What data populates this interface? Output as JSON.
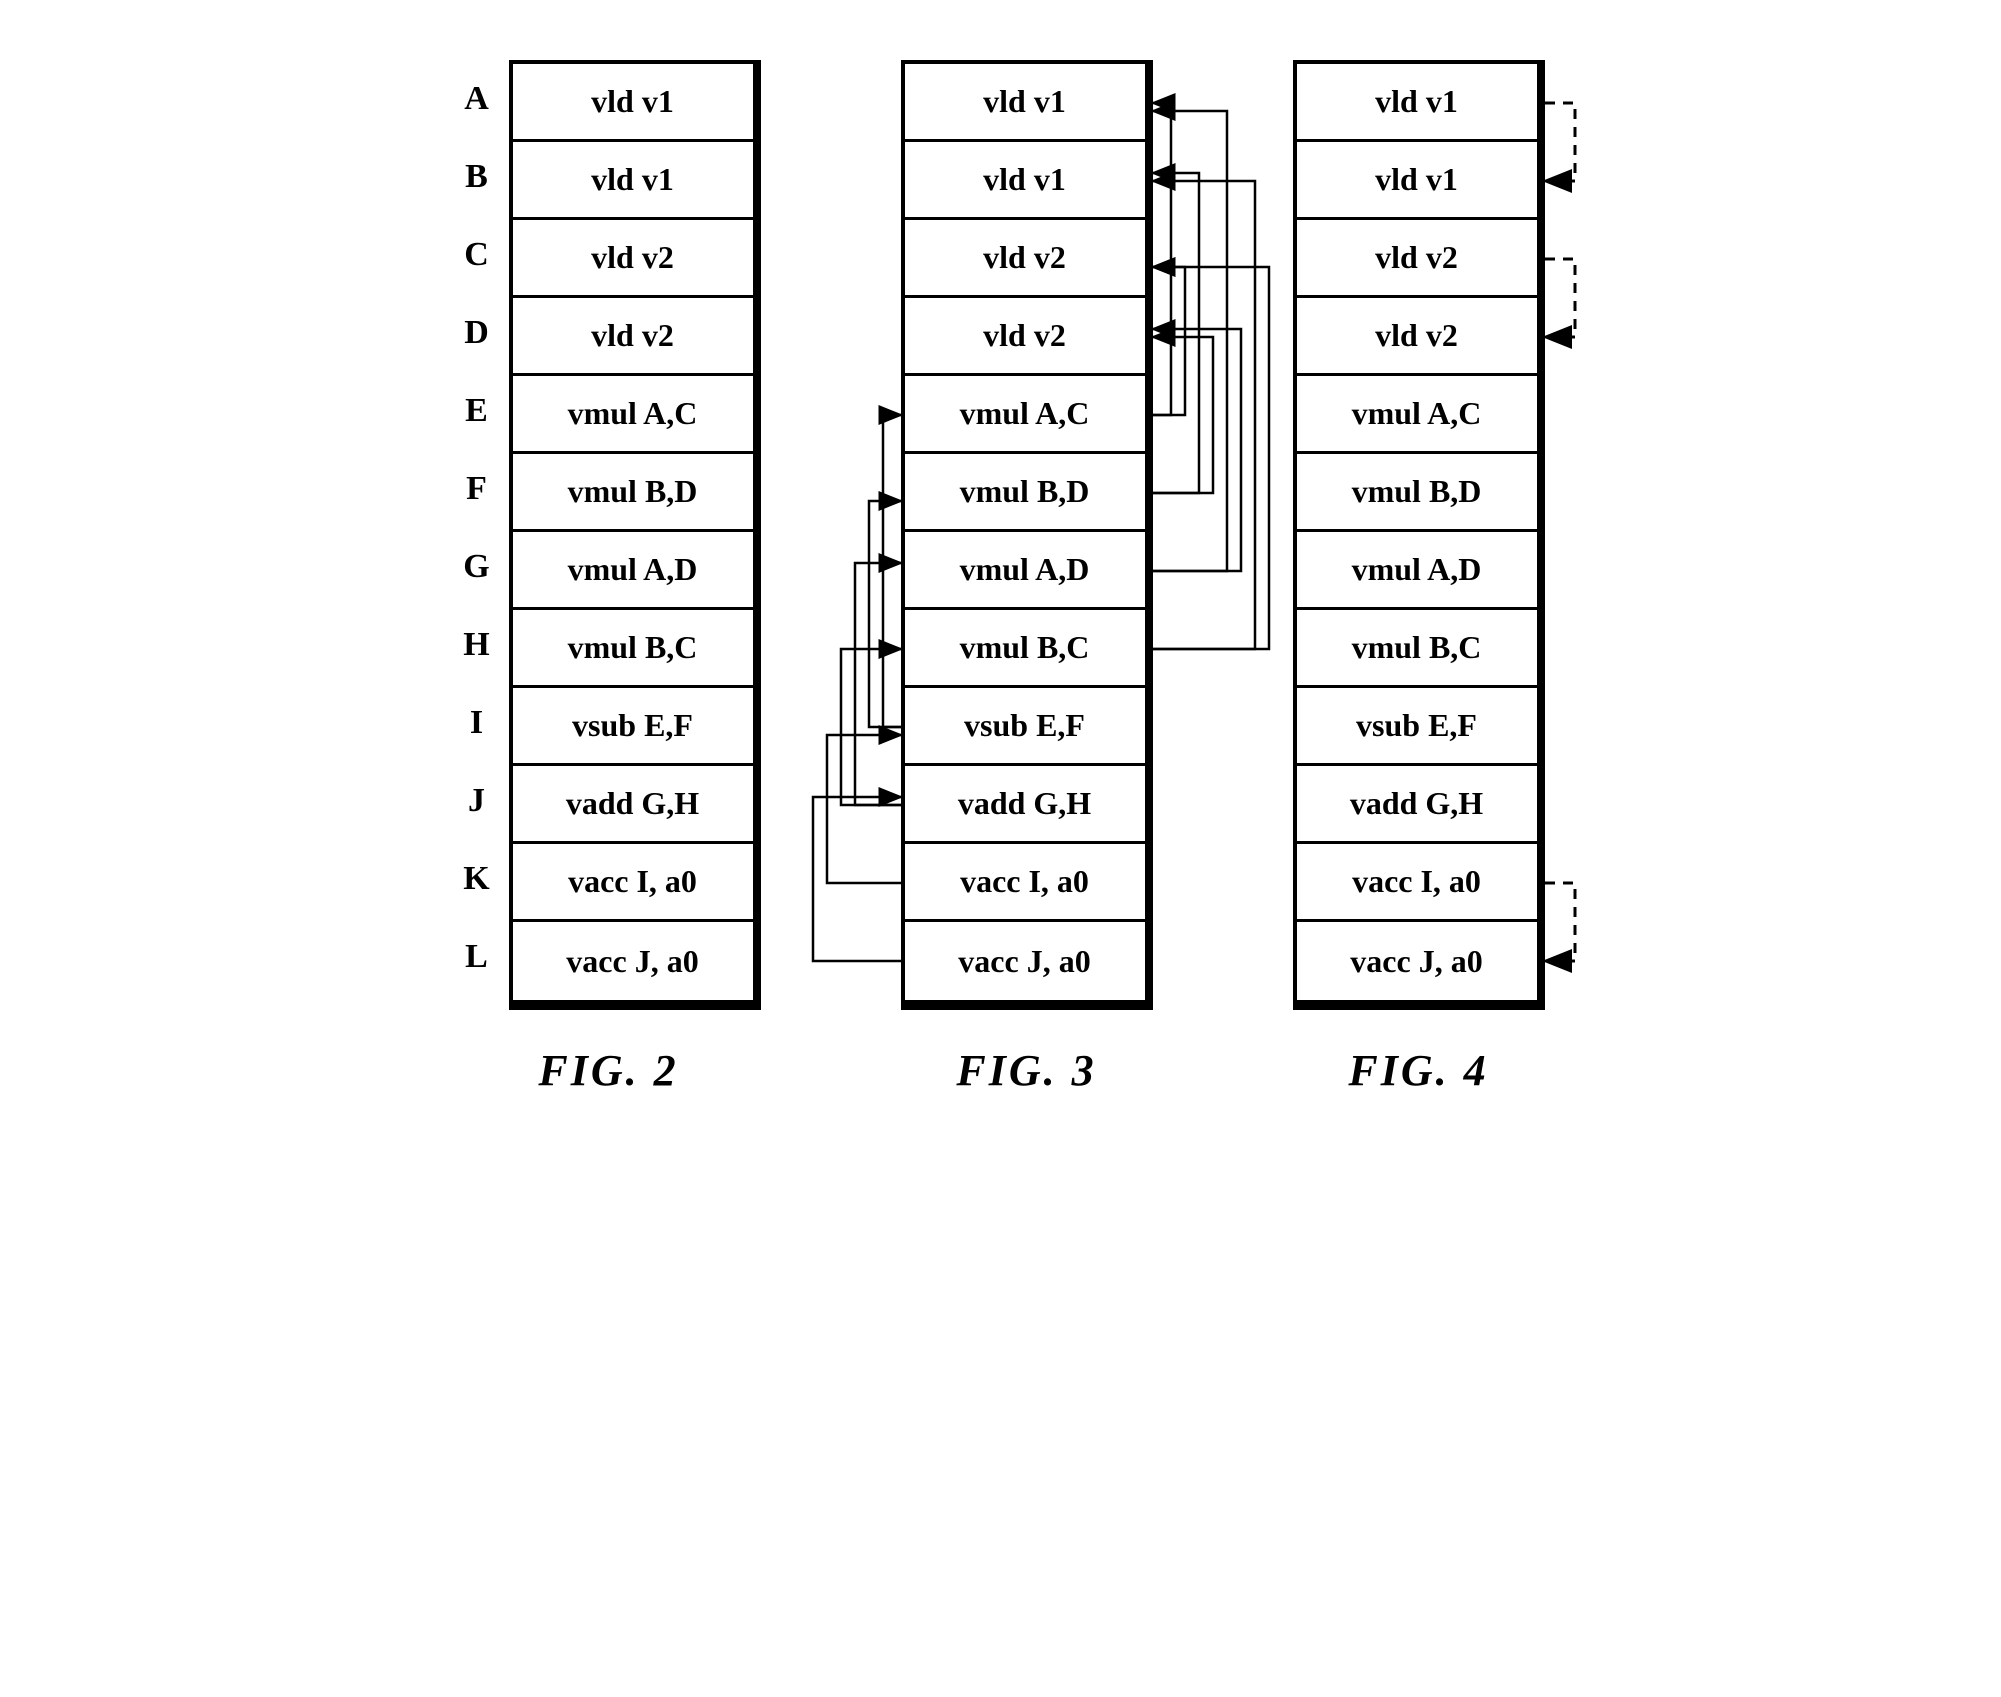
{
  "row_labels": [
    "A",
    "B",
    "C",
    "D",
    "E",
    "F",
    "G",
    "H",
    "I",
    "J",
    "K",
    "L"
  ],
  "instructions": [
    "vld v1",
    "vld v1",
    "vld v2",
    "vld v2",
    "vmul A,C",
    "vmul B,D",
    "vmul A,D",
    "vmul B,C",
    "vsub E,F",
    "vadd G,H",
    "vacc I, a0",
    "vacc J, a0"
  ],
  "captions": {
    "fig2": "FIG. 2",
    "fig3": "FIG. 3",
    "fig4": "FIG. 4"
  },
  "fig3_dependencies": [
    {
      "from": 4,
      "to": 0
    },
    {
      "from": 4,
      "to": 2
    },
    {
      "from": 5,
      "to": 1
    },
    {
      "from": 5,
      "to": 3
    },
    {
      "from": 6,
      "to": 0
    },
    {
      "from": 6,
      "to": 3
    },
    {
      "from": 7,
      "to": 1
    },
    {
      "from": 7,
      "to": 2
    },
    {
      "from": 8,
      "to": 4
    },
    {
      "from": 8,
      "to": 5
    },
    {
      "from": 9,
      "to": 6
    },
    {
      "from": 9,
      "to": 7
    },
    {
      "from": 10,
      "to": 8
    },
    {
      "from": 11,
      "to": 9
    }
  ],
  "fig4_dependencies": [
    {
      "from": 0,
      "to": 1
    },
    {
      "from": 2,
      "to": 3
    },
    {
      "from": 10,
      "to": 11
    }
  ]
}
